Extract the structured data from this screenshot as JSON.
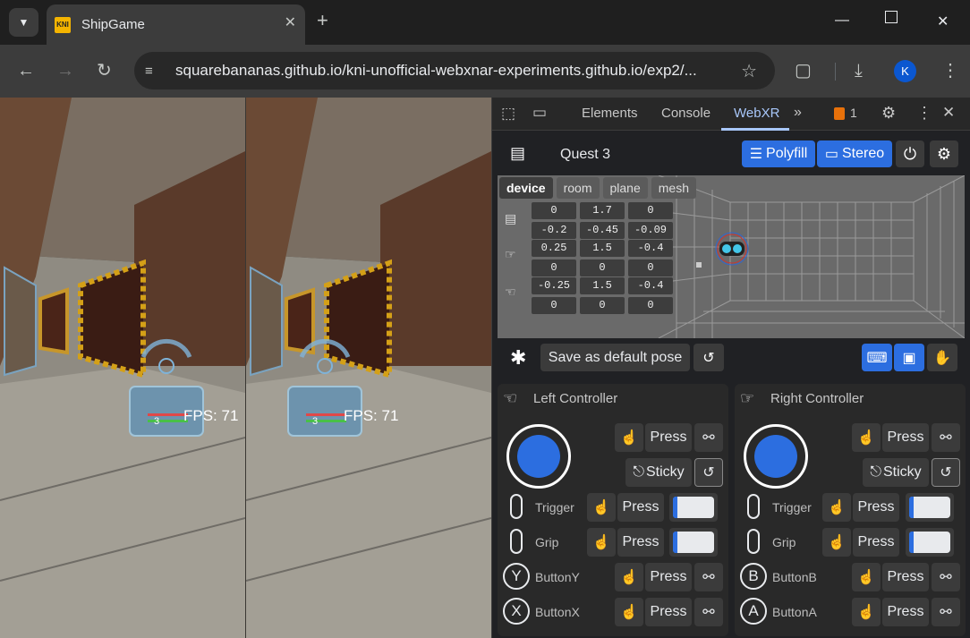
{
  "browser": {
    "tab_title": "ShipGame",
    "favicon_text": "KNI",
    "url": "squarebananas.github.io/kni-unofficial-webxnar-experiments.github.io/exp2/...",
    "profile_initial": "K"
  },
  "page": {
    "fps_left": "FPS: 71",
    "fps_right": "FPS: 71",
    "hud_number": "3"
  },
  "devtools": {
    "tabs": [
      "Elements",
      "Console",
      "WebXR"
    ],
    "active_tab": "WebXR",
    "issues_count": "1"
  },
  "webxr": {
    "device_name": "Quest 3",
    "polyfill_label": "Polyfill",
    "stereo_label": "Stereo",
    "scene_tabs": [
      "device",
      "room",
      "plane",
      "mesh"
    ],
    "active_scene_tab": "device",
    "headset": {
      "pos": [
        "0",
        "1.7",
        "0"
      ],
      "rot": [
        "-0.2",
        "-0.45",
        "-0.09"
      ]
    },
    "left_ctrl_pose": {
      "pos": [
        "0.25",
        "1.5",
        "-0.4"
      ],
      "rot": [
        "0",
        "0",
        "0"
      ]
    },
    "right_ctrl_pose": {
      "pos": [
        "-0.25",
        "1.5",
        "-0.4"
      ],
      "rot": [
        "0",
        "0",
        "0"
      ]
    },
    "save_pose_label": "Save as default pose"
  },
  "left_controller": {
    "title": "Left Controller",
    "press_label": "Press",
    "sticky_label": "Sticky",
    "trigger_label": "Trigger",
    "grip_label": "Grip",
    "button1_label": "ButtonY",
    "button1_letter": "Y",
    "button2_label": "ButtonX",
    "button2_letter": "X",
    "trigger_value": 0.1,
    "grip_value": 0.1
  },
  "right_controller": {
    "title": "Right Controller",
    "press_label": "Press",
    "sticky_label": "Sticky",
    "trigger_label": "Trigger",
    "grip_label": "Grip",
    "button1_label": "ButtonB",
    "button1_letter": "B",
    "button2_label": "ButtonA",
    "button2_letter": "A",
    "trigger_value": 0.1,
    "grip_value": 0.1
  },
  "colors": {
    "accent": "#2c6ee0",
    "link": "#a8c7fa"
  }
}
